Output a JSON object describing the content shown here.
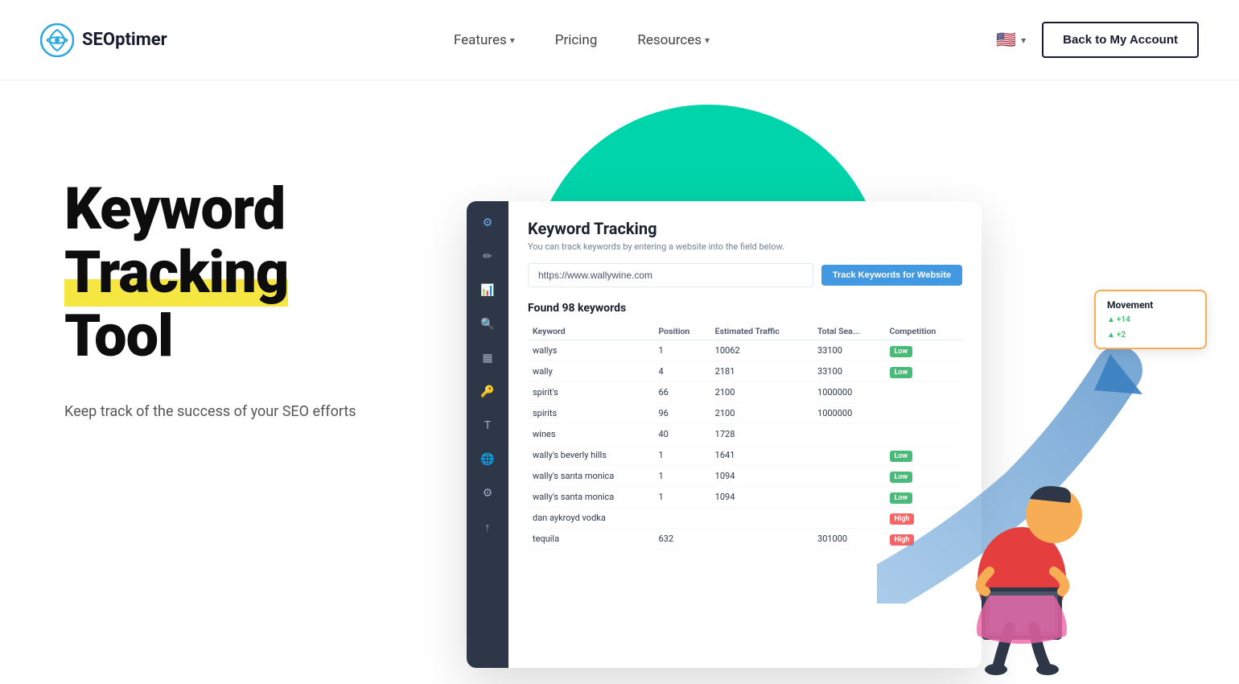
{
  "header": {
    "logo_text": "SEOptimer",
    "nav": {
      "features_label": "Features",
      "pricing_label": "Pricing",
      "resources_label": "Resources"
    },
    "back_button_label": "Back to My Account"
  },
  "hero": {
    "title_line1": "Keyword",
    "title_line2": "Tracking",
    "title_line3": "Tool",
    "subtitle": "Keep track of the success of your SEO efforts"
  },
  "dashboard": {
    "title": "Keyword Tracking",
    "subtitle": "You can track keywords by entering a website into the field below.",
    "search_value": "https://www.wallywine.com",
    "track_button": "Track Keywords for Website",
    "found_text": "Found 98 keywords",
    "movement_label": "Movement",
    "table": {
      "headers": [
        "Keyword",
        "Position",
        "Estimated Traffic",
        "Total Sea...",
        "Competition"
      ],
      "rows": [
        {
          "keyword": "wallys",
          "position": "1",
          "traffic": "10062",
          "total": "33100",
          "badge": "low",
          "movement": "+14"
        },
        {
          "keyword": "wally",
          "position": "4",
          "traffic": "2181",
          "total": "33100",
          "badge": "low",
          "movement": "+2"
        },
        {
          "keyword": "spirit's",
          "position": "66",
          "traffic": "2100",
          "total": "1000000",
          "badge": "",
          "movement": ""
        },
        {
          "keyword": "spirits",
          "position": "96",
          "traffic": "2100",
          "total": "1000000",
          "badge": "",
          "movement": ""
        },
        {
          "keyword": "wines",
          "position": "40",
          "traffic": "1728",
          "total": "",
          "badge": "",
          "movement": ""
        },
        {
          "keyword": "wally's beverly hills",
          "position": "1",
          "traffic": "1641",
          "total": "",
          "badge": "low",
          "movement": ""
        },
        {
          "keyword": "wally's santa monica",
          "position": "1",
          "traffic": "1094",
          "total": "",
          "badge": "low",
          "movement": ""
        },
        {
          "keyword": "wally's santa monica",
          "position": "1",
          "traffic": "1094",
          "total": "",
          "badge": "low",
          "movement": ""
        },
        {
          "keyword": "dan aykroyd vodka",
          "position": "",
          "traffic": "",
          "total": "",
          "badge": "high",
          "movement": ""
        },
        {
          "keyword": "tequila",
          "position": "632",
          "traffic": "",
          "total": "301000",
          "badge": "high",
          "movement": ""
        }
      ]
    }
  }
}
